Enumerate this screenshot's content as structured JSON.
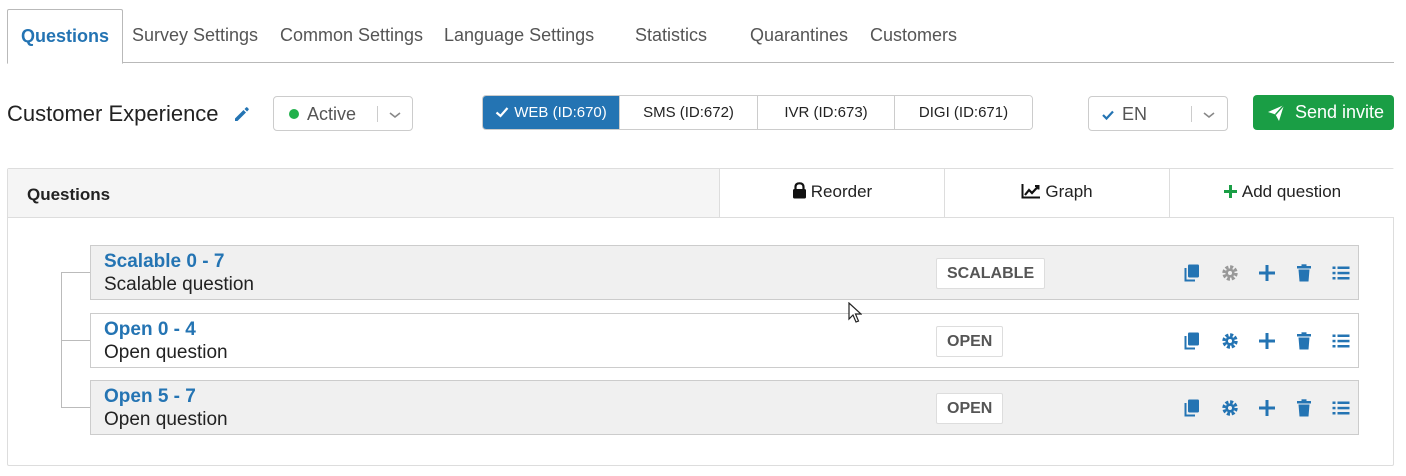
{
  "tabs": [
    {
      "label": "Questions",
      "active": true
    },
    {
      "label": "Survey Settings",
      "active": false
    },
    {
      "label": "Common Settings",
      "active": false
    },
    {
      "label": "Language Settings",
      "active": false
    },
    {
      "label": "Statistics",
      "active": false
    },
    {
      "label": "Quarantines",
      "active": false
    },
    {
      "label": "Customers",
      "active": false
    }
  ],
  "survey": {
    "title": "Customer Experience",
    "status": "Active",
    "status_color": "#22b14c"
  },
  "channels": [
    {
      "label": "WEB (ID:670)",
      "active": true
    },
    {
      "label": "SMS (ID:672)",
      "active": false
    },
    {
      "label": "IVR (ID:673)",
      "active": false
    },
    {
      "label": "DIGI (ID:671)",
      "active": false
    }
  ],
  "language": {
    "selected": "EN"
  },
  "send_invite": {
    "label": "Send invite"
  },
  "panel": {
    "title": "Questions",
    "reorder_label": "Reorder",
    "graph_label": "Graph",
    "add_label": "Add question"
  },
  "questions": [
    {
      "title": "Scalable 0 - 7",
      "subtitle": "Scalable question",
      "type": "SCALABLE",
      "settings_enabled": false
    },
    {
      "title": "Open 0 - 4",
      "subtitle": "Open question",
      "type": "OPEN",
      "settings_enabled": true
    },
    {
      "title": "Open 5 - 7",
      "subtitle": "Open question",
      "type": "OPEN",
      "settings_enabled": true
    }
  ],
  "colors": {
    "accent": "#2474b3",
    "send": "#1a9e45",
    "add_icon": "#1a9e45",
    "disabled_icon": "#999999"
  },
  "icons": {
    "edit": "pencil-icon",
    "copy": "copy-icon",
    "settings": "gear-icon",
    "add": "plus-icon",
    "delete": "trash-icon",
    "list": "list-icon",
    "lock": "lock-icon",
    "graph": "chart-line-icon",
    "send": "paper-plane-icon"
  }
}
